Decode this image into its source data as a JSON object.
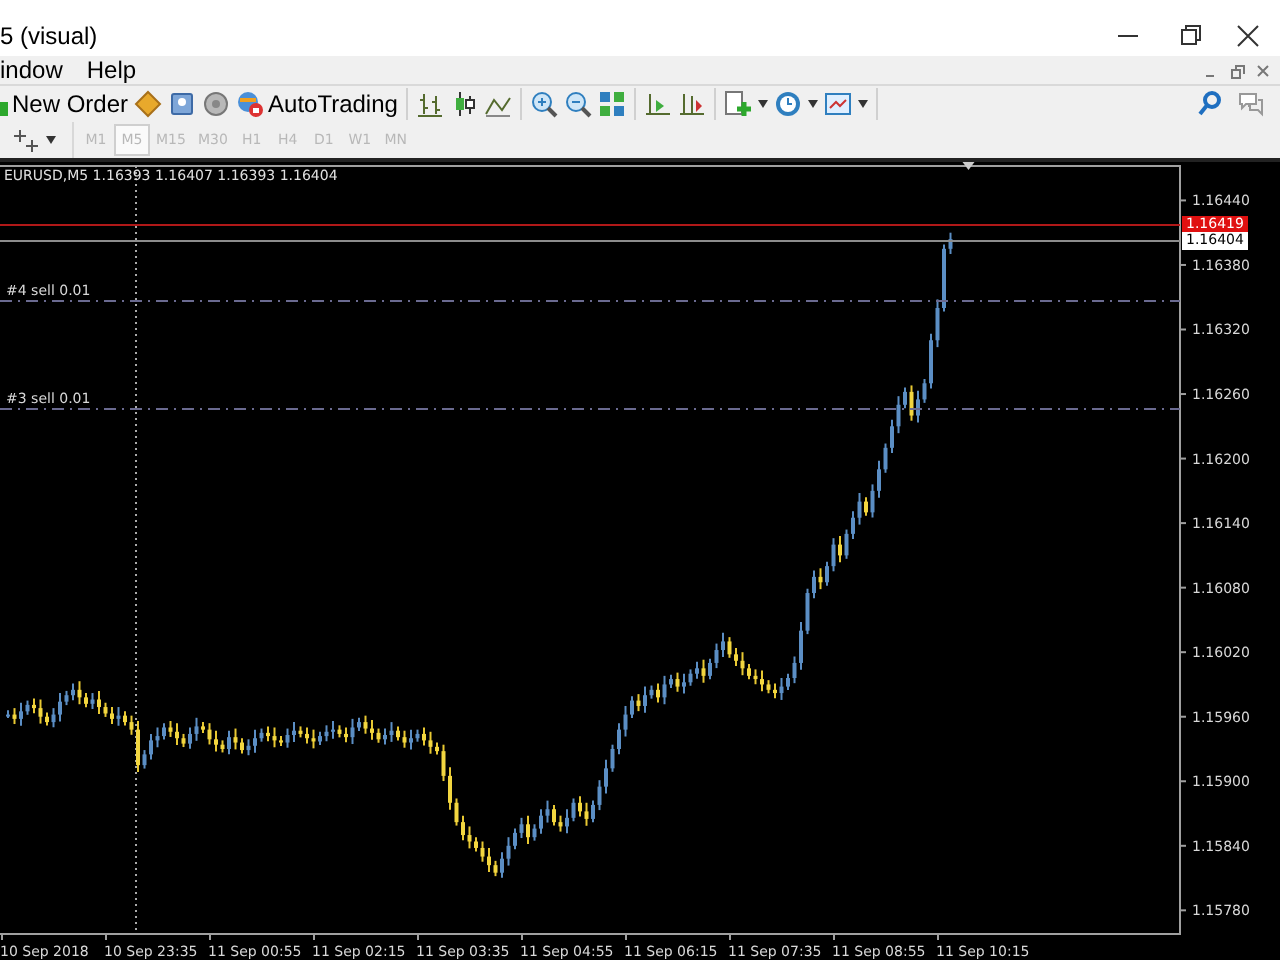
{
  "window": {
    "title": "5 (visual)"
  },
  "menu": [
    {
      "label": "indow"
    },
    {
      "label": "Help"
    }
  ],
  "toolbar": {
    "new_order": "New Order",
    "autotrading": "AutoTrading"
  },
  "timeframes": [
    {
      "label": "M1",
      "selected": false
    },
    {
      "label": "M5",
      "selected": true
    },
    {
      "label": "M15",
      "selected": false
    },
    {
      "label": "M30",
      "selected": false
    },
    {
      "label": "H1",
      "selected": false
    },
    {
      "label": "H4",
      "selected": false
    },
    {
      "label": "D1",
      "selected": false
    },
    {
      "label": "W1",
      "selected": false
    },
    {
      "label": "MN",
      "selected": false
    }
  ],
  "chart": {
    "header": "EURUSD,M5  1.16393 1.16407 1.16393 1.16404",
    "price_labels": [
      "1.16440",
      "1.16380",
      "1.16320",
      "1.16260",
      "1.16200",
      "1.16140",
      "1.16080",
      "1.16020",
      "1.15960",
      "1.15900",
      "1.15840",
      "1.15780"
    ],
    "time_labels": [
      "10 Sep 2018",
      "10 Sep 23:35",
      "11 Sep 00:55",
      "11 Sep 02:15",
      "11 Sep 03:35",
      "11 Sep 04:55",
      "11 Sep 06:15",
      "11 Sep 07:35",
      "11 Sep 08:55",
      "11 Sep 10:15"
    ],
    "orders": [
      {
        "label": "#4 sell 0.01"
      },
      {
        "label": "#3 sell 0.01"
      }
    ],
    "ask": "1.16419",
    "bid": "1.16404"
  }
}
